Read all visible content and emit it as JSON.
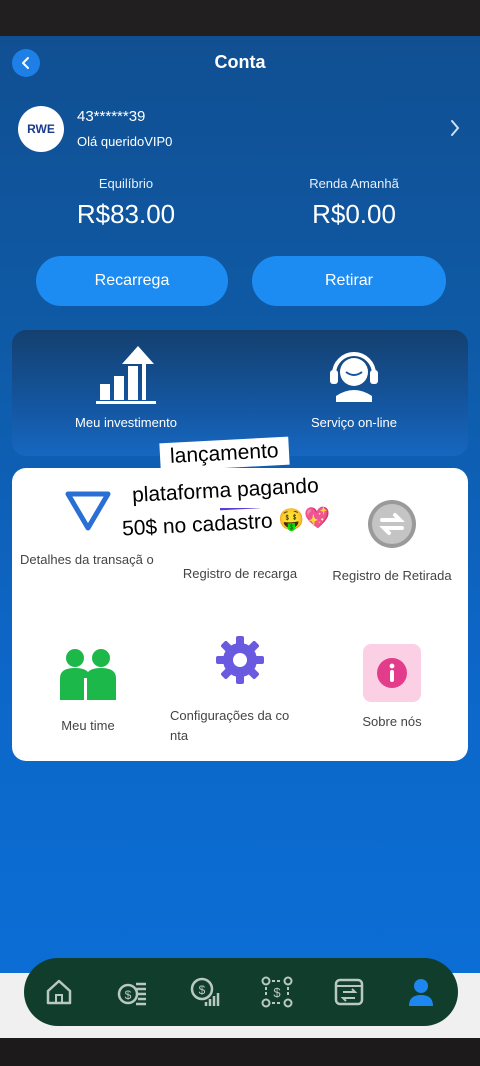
{
  "header": {
    "title": "Conta"
  },
  "profile": {
    "logo_text": "RWE",
    "user_id": "43******39",
    "greeting": "Olá queridoVIP0"
  },
  "balances": {
    "equilibrio_label": "Equilíbrio",
    "equilibrio_value": "R$83.00",
    "renda_label": "Renda Amanhã",
    "renda_value": "R$0.00"
  },
  "actions": {
    "recharge_label": "Recarrega",
    "withdraw_label": "Retirar"
  },
  "quick": {
    "investment_label": "Meu investimento",
    "service_label": "Serviço on-line"
  },
  "menu": {
    "transactions_label": "Detalhes da transaçã o",
    "recharge_log_label": "Registro de recarga",
    "withdraw_log_label": "Registro de Retirada",
    "team_label": "Meu time",
    "account_settings_label": "Configurações da co nta",
    "about_label": "Sobre nós"
  },
  "promo": {
    "line1": "lançamento",
    "line2": "plataforma pagando",
    "line3": "50$ no cadastro 🤑💖"
  },
  "nav": [
    "home-icon",
    "coins-icon",
    "income-icon",
    "scan-icon",
    "exchange-icon",
    "profile-icon"
  ],
  "colors": {
    "accent": "#1c8cf2",
    "nav_bg": "#103d2c",
    "active_nav": "#1e86f0"
  }
}
